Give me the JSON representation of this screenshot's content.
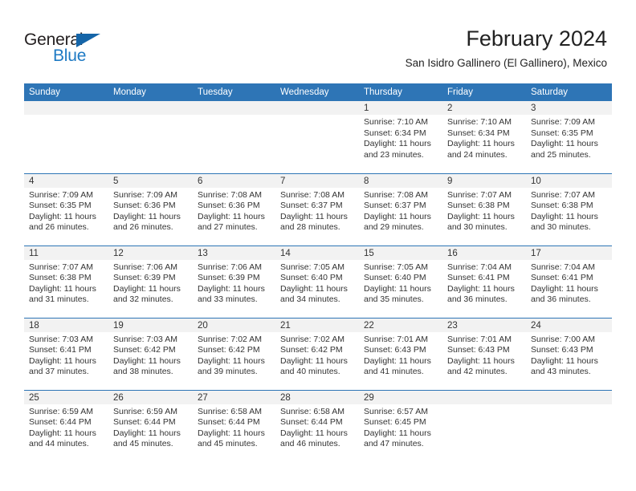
{
  "brand": {
    "name_part1": "General",
    "name_part2": "Blue",
    "triangle_color": "#1565a8",
    "blue_color": "#1e7ac4"
  },
  "header": {
    "title": "February 2024",
    "subtitle": "San Isidro Gallinero (El Gallinero), Mexico"
  },
  "theme": {
    "header_blue": "#2e75b6",
    "daynum_band": "#f2f2f2",
    "text": "#333333"
  },
  "calendar": {
    "weekday_headers": [
      "Sunday",
      "Monday",
      "Tuesday",
      "Wednesday",
      "Thursday",
      "Friday",
      "Saturday"
    ],
    "labels": {
      "sunrise": "Sunrise:",
      "sunset": "Sunset:",
      "daylight": "Daylight:"
    },
    "weeks": [
      [
        {
          "day": "",
          "empty": true
        },
        {
          "day": "",
          "empty": true
        },
        {
          "day": "",
          "empty": true
        },
        {
          "day": "",
          "empty": true
        },
        {
          "day": "1",
          "sunrise": "Sunrise: 7:10 AM",
          "sunset": "Sunset: 6:34 PM",
          "daylight_l1": "Daylight: 11 hours",
          "daylight_l2": "and 23 minutes."
        },
        {
          "day": "2",
          "sunrise": "Sunrise: 7:10 AM",
          "sunset": "Sunset: 6:34 PM",
          "daylight_l1": "Daylight: 11 hours",
          "daylight_l2": "and 24 minutes."
        },
        {
          "day": "3",
          "sunrise": "Sunrise: 7:09 AM",
          "sunset": "Sunset: 6:35 PM",
          "daylight_l1": "Daylight: 11 hours",
          "daylight_l2": "and 25 minutes."
        }
      ],
      [
        {
          "day": "4",
          "sunrise": "Sunrise: 7:09 AM",
          "sunset": "Sunset: 6:35 PM",
          "daylight_l1": "Daylight: 11 hours",
          "daylight_l2": "and 26 minutes."
        },
        {
          "day": "5",
          "sunrise": "Sunrise: 7:09 AM",
          "sunset": "Sunset: 6:36 PM",
          "daylight_l1": "Daylight: 11 hours",
          "daylight_l2": "and 26 minutes."
        },
        {
          "day": "6",
          "sunrise": "Sunrise: 7:08 AM",
          "sunset": "Sunset: 6:36 PM",
          "daylight_l1": "Daylight: 11 hours",
          "daylight_l2": "and 27 minutes."
        },
        {
          "day": "7",
          "sunrise": "Sunrise: 7:08 AM",
          "sunset": "Sunset: 6:37 PM",
          "daylight_l1": "Daylight: 11 hours",
          "daylight_l2": "and 28 minutes."
        },
        {
          "day": "8",
          "sunrise": "Sunrise: 7:08 AM",
          "sunset": "Sunset: 6:37 PM",
          "daylight_l1": "Daylight: 11 hours",
          "daylight_l2": "and 29 minutes."
        },
        {
          "day": "9",
          "sunrise": "Sunrise: 7:07 AM",
          "sunset": "Sunset: 6:38 PM",
          "daylight_l1": "Daylight: 11 hours",
          "daylight_l2": "and 30 minutes."
        },
        {
          "day": "10",
          "sunrise": "Sunrise: 7:07 AM",
          "sunset": "Sunset: 6:38 PM",
          "daylight_l1": "Daylight: 11 hours",
          "daylight_l2": "and 30 minutes."
        }
      ],
      [
        {
          "day": "11",
          "sunrise": "Sunrise: 7:07 AM",
          "sunset": "Sunset: 6:38 PM",
          "daylight_l1": "Daylight: 11 hours",
          "daylight_l2": "and 31 minutes."
        },
        {
          "day": "12",
          "sunrise": "Sunrise: 7:06 AM",
          "sunset": "Sunset: 6:39 PM",
          "daylight_l1": "Daylight: 11 hours",
          "daylight_l2": "and 32 minutes."
        },
        {
          "day": "13",
          "sunrise": "Sunrise: 7:06 AM",
          "sunset": "Sunset: 6:39 PM",
          "daylight_l1": "Daylight: 11 hours",
          "daylight_l2": "and 33 minutes."
        },
        {
          "day": "14",
          "sunrise": "Sunrise: 7:05 AM",
          "sunset": "Sunset: 6:40 PM",
          "daylight_l1": "Daylight: 11 hours",
          "daylight_l2": "and 34 minutes."
        },
        {
          "day": "15",
          "sunrise": "Sunrise: 7:05 AM",
          "sunset": "Sunset: 6:40 PM",
          "daylight_l1": "Daylight: 11 hours",
          "daylight_l2": "and 35 minutes."
        },
        {
          "day": "16",
          "sunrise": "Sunrise: 7:04 AM",
          "sunset": "Sunset: 6:41 PM",
          "daylight_l1": "Daylight: 11 hours",
          "daylight_l2": "and 36 minutes."
        },
        {
          "day": "17",
          "sunrise": "Sunrise: 7:04 AM",
          "sunset": "Sunset: 6:41 PM",
          "daylight_l1": "Daylight: 11 hours",
          "daylight_l2": "and 36 minutes."
        }
      ],
      [
        {
          "day": "18",
          "sunrise": "Sunrise: 7:03 AM",
          "sunset": "Sunset: 6:41 PM",
          "daylight_l1": "Daylight: 11 hours",
          "daylight_l2": "and 37 minutes."
        },
        {
          "day": "19",
          "sunrise": "Sunrise: 7:03 AM",
          "sunset": "Sunset: 6:42 PM",
          "daylight_l1": "Daylight: 11 hours",
          "daylight_l2": "and 38 minutes."
        },
        {
          "day": "20",
          "sunrise": "Sunrise: 7:02 AM",
          "sunset": "Sunset: 6:42 PM",
          "daylight_l1": "Daylight: 11 hours",
          "daylight_l2": "and 39 minutes."
        },
        {
          "day": "21",
          "sunrise": "Sunrise: 7:02 AM",
          "sunset": "Sunset: 6:42 PM",
          "daylight_l1": "Daylight: 11 hours",
          "daylight_l2": "and 40 minutes."
        },
        {
          "day": "22",
          "sunrise": "Sunrise: 7:01 AM",
          "sunset": "Sunset: 6:43 PM",
          "daylight_l1": "Daylight: 11 hours",
          "daylight_l2": "and 41 minutes."
        },
        {
          "day": "23",
          "sunrise": "Sunrise: 7:01 AM",
          "sunset": "Sunset: 6:43 PM",
          "daylight_l1": "Daylight: 11 hours",
          "daylight_l2": "and 42 minutes."
        },
        {
          "day": "24",
          "sunrise": "Sunrise: 7:00 AM",
          "sunset": "Sunset: 6:43 PM",
          "daylight_l1": "Daylight: 11 hours",
          "daylight_l2": "and 43 minutes."
        }
      ],
      [
        {
          "day": "25",
          "sunrise": "Sunrise: 6:59 AM",
          "sunset": "Sunset: 6:44 PM",
          "daylight_l1": "Daylight: 11 hours",
          "daylight_l2": "and 44 minutes."
        },
        {
          "day": "26",
          "sunrise": "Sunrise: 6:59 AM",
          "sunset": "Sunset: 6:44 PM",
          "daylight_l1": "Daylight: 11 hours",
          "daylight_l2": "and 45 minutes."
        },
        {
          "day": "27",
          "sunrise": "Sunrise: 6:58 AM",
          "sunset": "Sunset: 6:44 PM",
          "daylight_l1": "Daylight: 11 hours",
          "daylight_l2": "and 45 minutes."
        },
        {
          "day": "28",
          "sunrise": "Sunrise: 6:58 AM",
          "sunset": "Sunset: 6:44 PM",
          "daylight_l1": "Daylight: 11 hours",
          "daylight_l2": "and 46 minutes."
        },
        {
          "day": "29",
          "sunrise": "Sunrise: 6:57 AM",
          "sunset": "Sunset: 6:45 PM",
          "daylight_l1": "Daylight: 11 hours",
          "daylight_l2": "and 47 minutes."
        },
        {
          "day": "",
          "empty": true
        },
        {
          "day": "",
          "empty": true
        }
      ]
    ]
  }
}
